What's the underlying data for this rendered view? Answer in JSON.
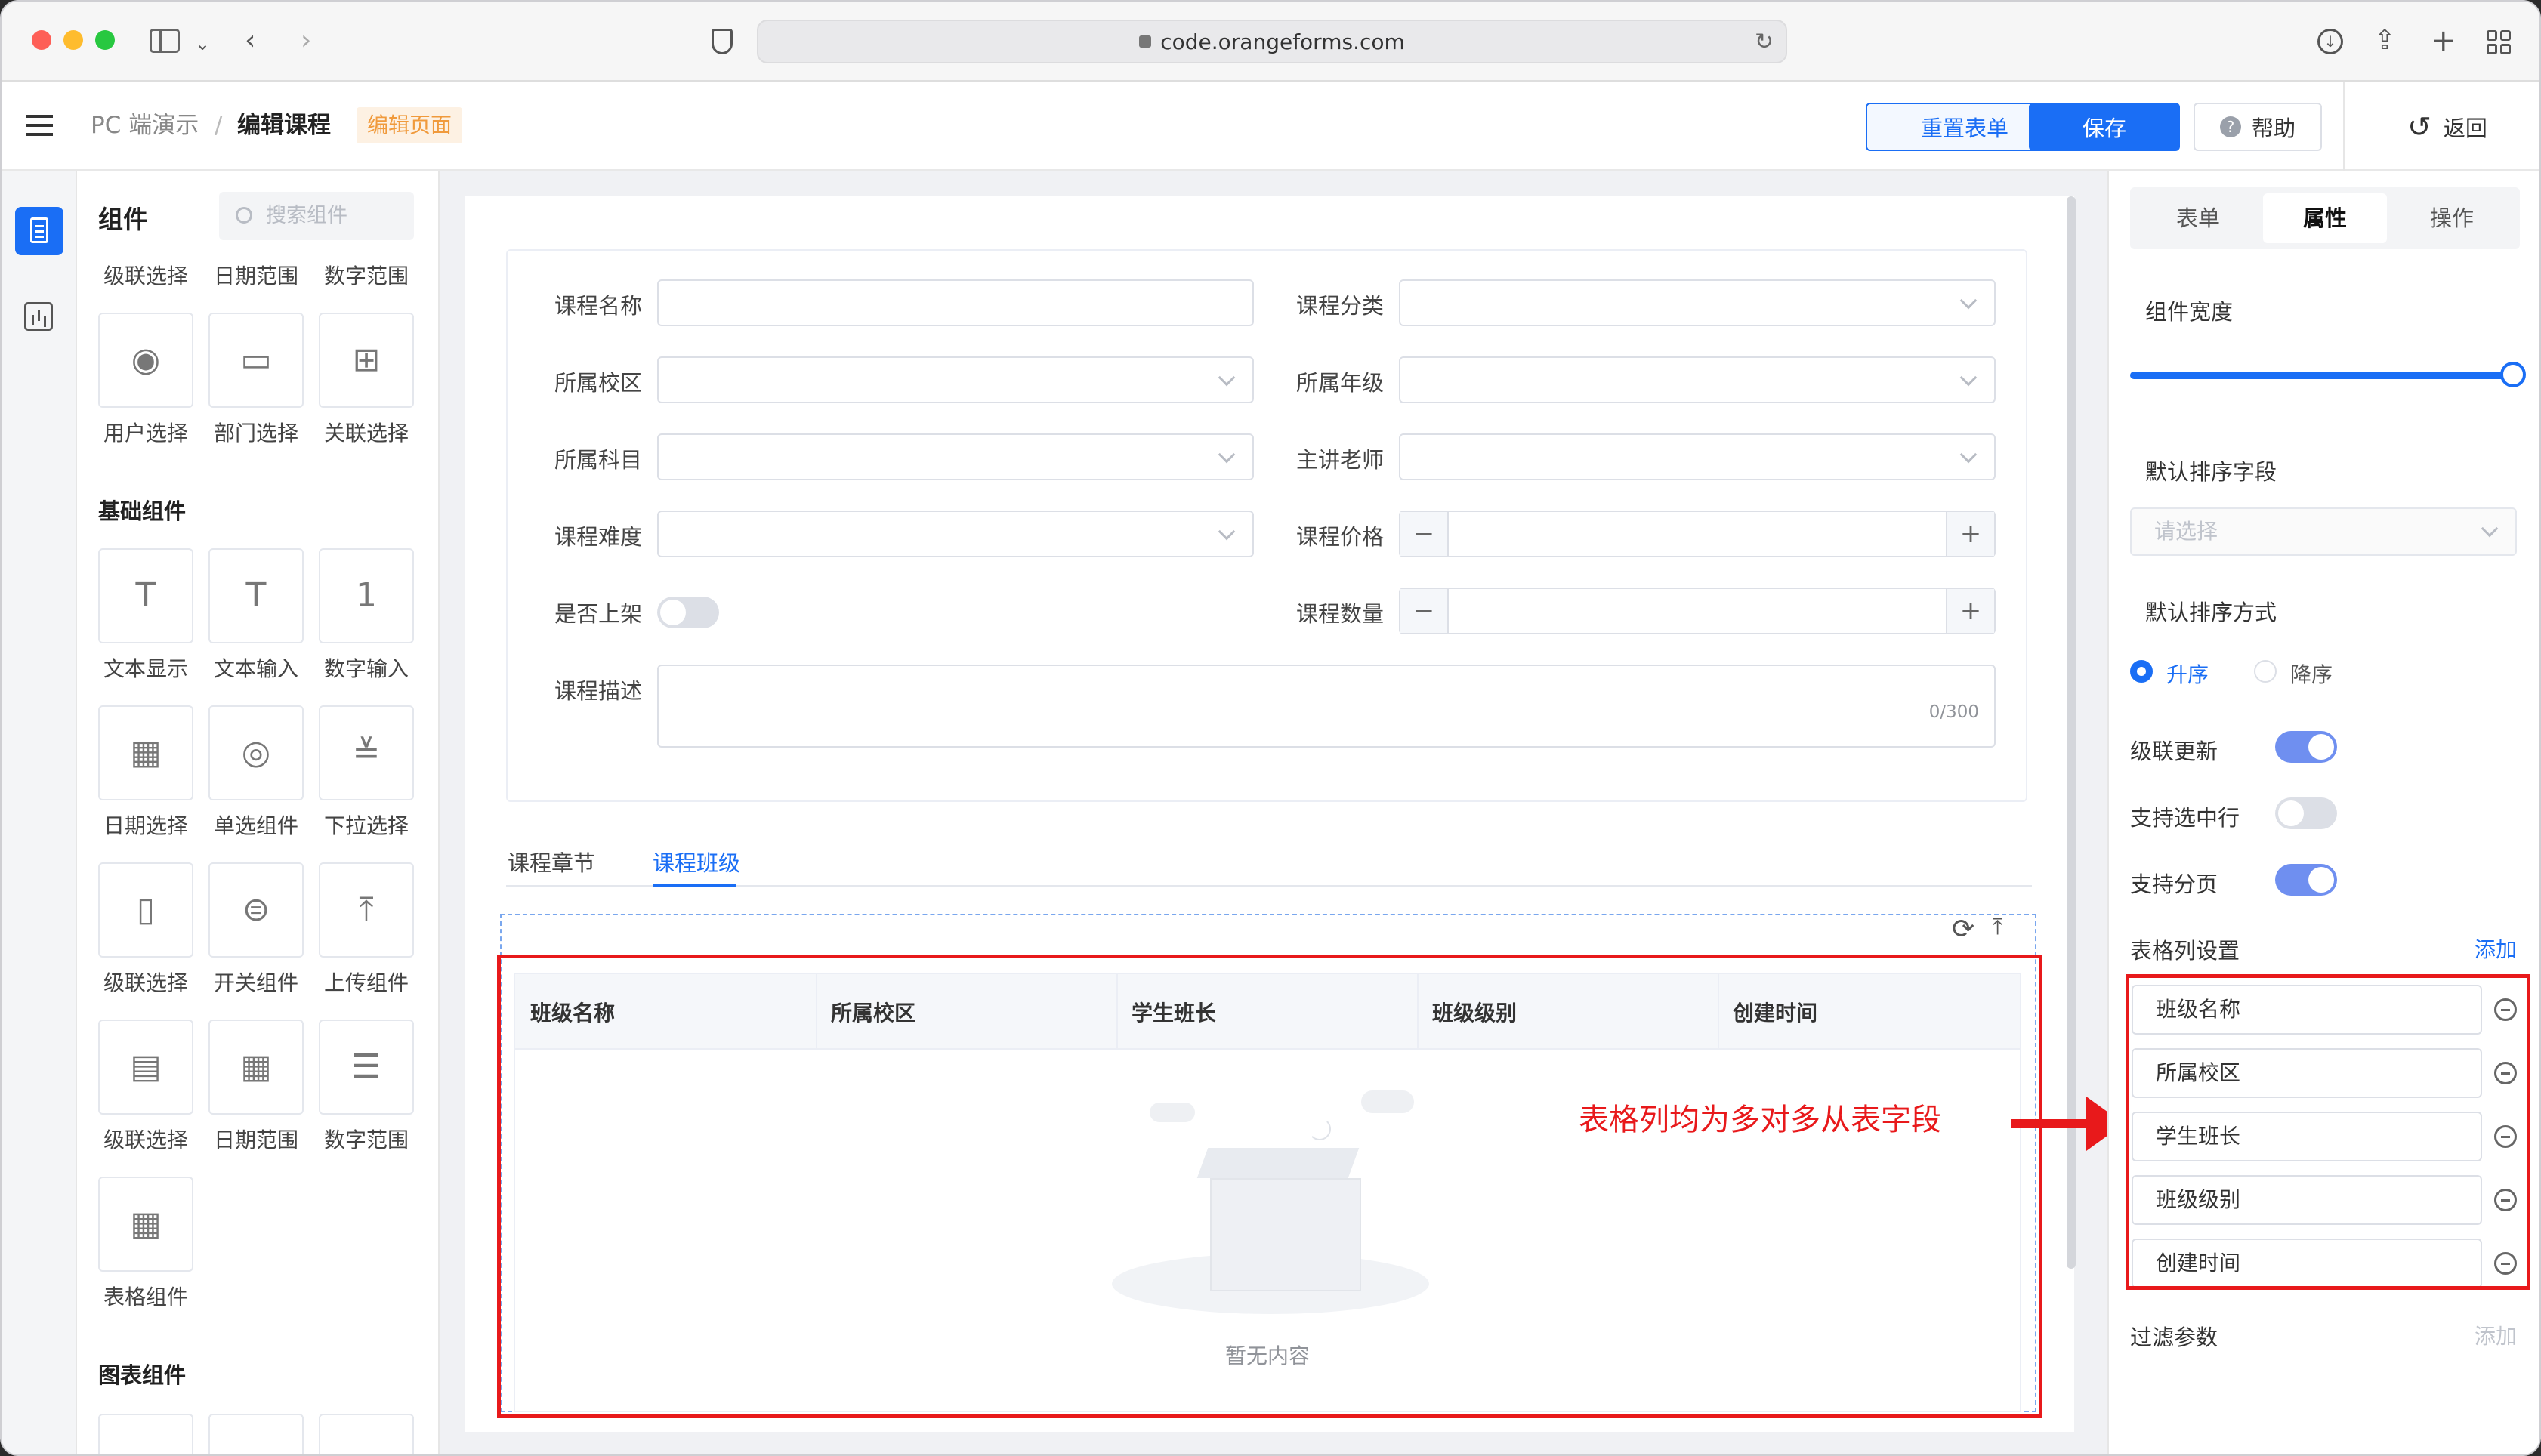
{
  "browser": {
    "url": "code.orangeforms.com"
  },
  "header": {
    "crumb_root": "PC 端演示",
    "crumb_sep": "/",
    "crumb_current": "编辑课程",
    "badge": "编辑页面",
    "reset_label": "重置表单",
    "save_label": "保存",
    "help_label": "帮助",
    "back_label": "返回"
  },
  "components": {
    "title": "组件",
    "search_placeholder": "搜索组件",
    "top_row": [
      "级联选择",
      "日期范围",
      "数字范围"
    ],
    "row1": [
      "用户选择",
      "部门选择",
      "关联选择"
    ],
    "basic_title": "基础组件",
    "row2": [
      "文本显示",
      "文本输入",
      "数字输入"
    ],
    "row3": [
      "日期选择",
      "单选组件",
      "下拉选择"
    ],
    "row4": [
      "级联选择",
      "开关组件",
      "上传组件"
    ],
    "row5": [
      "级联选择",
      "日期范围",
      "数字范围"
    ],
    "row6": [
      "表格组件"
    ],
    "chart_title": "图表组件"
  },
  "form": {
    "course_name": "课程名称",
    "course_category": "课程分类",
    "campus": "所属校区",
    "grade": "所属年级",
    "subject": "所属科目",
    "teacher": "主讲老师",
    "difficulty": "课程难度",
    "price": "课程价格",
    "on_shelf": "是否上架",
    "quantity": "课程数量",
    "description": "课程描述",
    "desc_counter": "0/300",
    "minus": "−",
    "plus": "+"
  },
  "tabs": [
    "课程章节",
    "课程班级"
  ],
  "table": {
    "columns": [
      "班级名称",
      "所属校区",
      "学生班长",
      "班级级别",
      "创建时间"
    ],
    "empty_text": "暂无内容"
  },
  "annotation": "表格列均为多对多从表字段",
  "panel": {
    "tabs": [
      "表单",
      "属性",
      "操作"
    ],
    "width_label": "组件宽度",
    "width_value": 1.0,
    "sort_field_label": "默认排序字段",
    "sort_field_placeholder": "请选择",
    "sort_order_label": "默认排序方式",
    "asc": "升序",
    "desc": "降序",
    "cascade_update": "级联更新",
    "row_select": "支持选中行",
    "pagination": "支持分页",
    "columns_label": "表格列设置",
    "add": "添加",
    "columns": [
      "班级名称",
      "所属校区",
      "学生班长",
      "班级级别",
      "创建时间"
    ],
    "filter_label": "过滤参数",
    "filter_add": "添加"
  },
  "colors": {
    "primary": "#1a6ef5",
    "annotation": "#e8191b",
    "badge_bg": "#fdf1e3",
    "badge_text": "#f09a3c"
  }
}
